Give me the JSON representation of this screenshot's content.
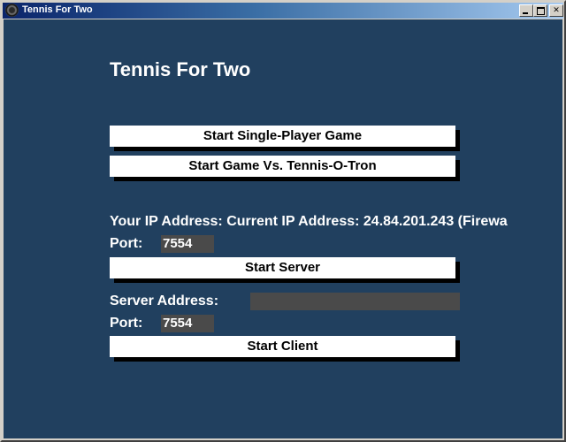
{
  "window": {
    "title": "Tennis For Two",
    "buttons": [
      "minimize",
      "maximize",
      "close"
    ]
  },
  "app": {
    "heading": "Tennis For Two",
    "single_player_label": "Start Single-Player Game",
    "vs_ai_label": "Start Game Vs. Tennis-O-Tron",
    "ip_label": "Your IP Address: ",
    "ip_value": "Current IP Address: 24.84.201.243 (Firewa",
    "server": {
      "port_label": "Port:",
      "port_value": "7554",
      "start_label": "Start Server"
    },
    "client": {
      "address_label": "Server Address:",
      "address_value": "",
      "port_label": "Port:",
      "port_value": "7554",
      "start_label": "Start Client"
    }
  },
  "colors": {
    "background": "#21405f",
    "button": "#ffffff",
    "field": "#4a4a4a",
    "titlebar_start": "#0a246a"
  },
  "icons": {
    "app": "tennis-ball-icon",
    "minimize": "minimize-icon",
    "maximize": "maximize-icon",
    "close": "close-icon"
  }
}
